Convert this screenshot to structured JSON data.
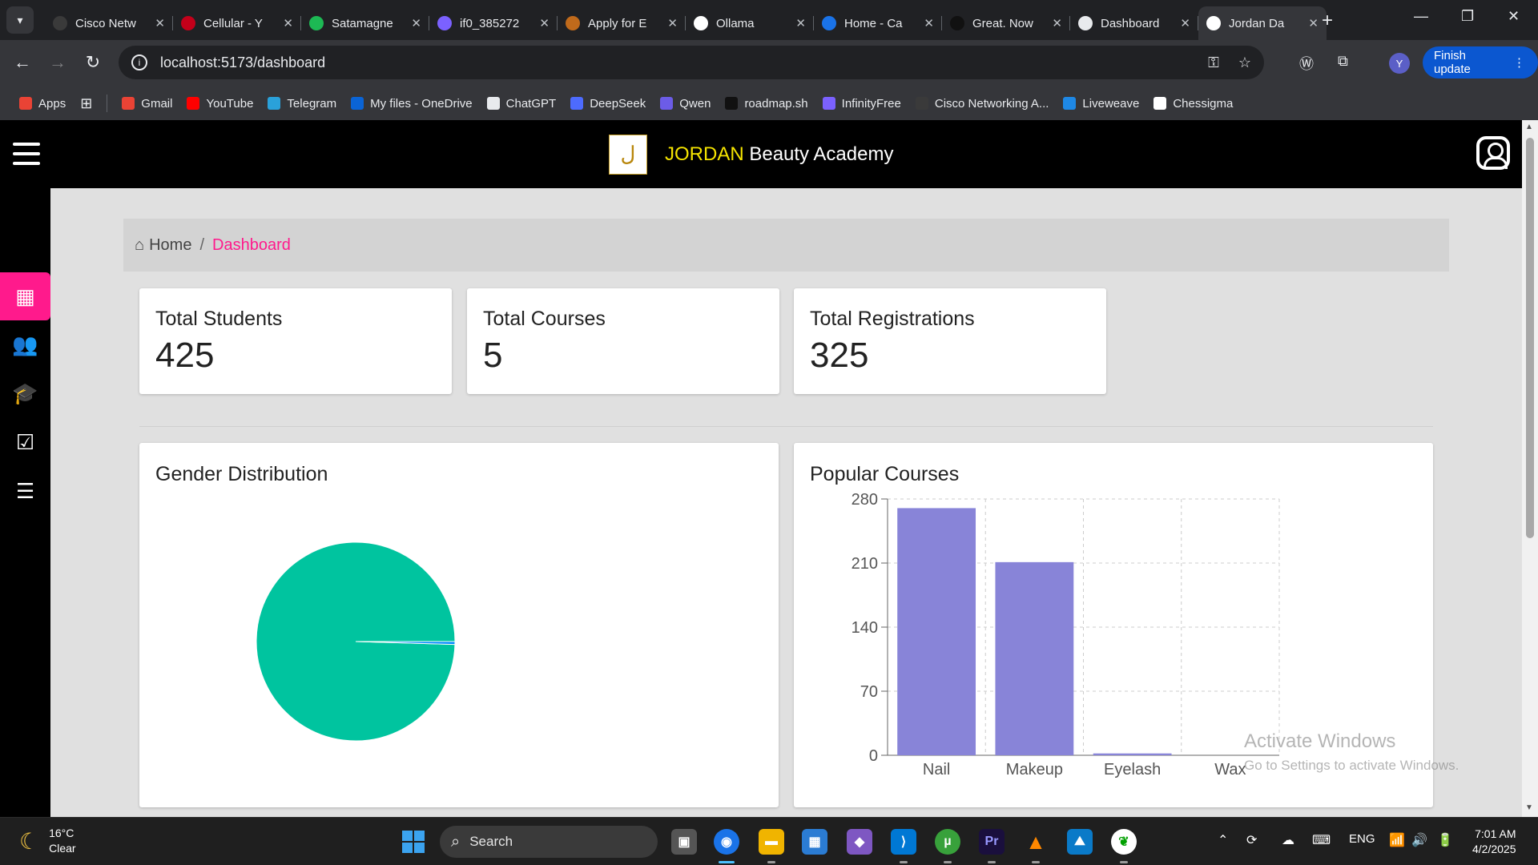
{
  "browser": {
    "tabs": [
      {
        "title": "Cisco Netw",
        "color": "#3a3a3a"
      },
      {
        "title": "Cellular - Y",
        "color": "#c4001a"
      },
      {
        "title": "Satamagne",
        "color": "#1db954"
      },
      {
        "title": "if0_385272",
        "color": "#7b61ff"
      },
      {
        "title": "Apply for E",
        "color": "#c06a1b"
      },
      {
        "title": "Ollama",
        "color": "#ffffff"
      },
      {
        "title": "Home - Ca",
        "color": "#1a73e8"
      },
      {
        "title": "Great. Now",
        "color": "#111111"
      },
      {
        "title": "Dashboard",
        "color": "#e8eaed"
      },
      {
        "title": "Jordan Da",
        "color": "#ffffff"
      }
    ],
    "url": "localhost:5173/dashboard",
    "finish_update": "Finish update",
    "profile_initial": "Y",
    "bookmarks": [
      {
        "label": "Apps",
        "color": "#ea4335"
      },
      {
        "label": "Gmail",
        "color": "#ea4335"
      },
      {
        "label": "YouTube",
        "color": "#ff0000"
      },
      {
        "label": "Telegram",
        "color": "#2aa1da"
      },
      {
        "label": "My files - OneDrive",
        "color": "#0a64d6"
      },
      {
        "label": "ChatGPT",
        "color": "#e8eaed"
      },
      {
        "label": "DeepSeek",
        "color": "#4d6bfe"
      },
      {
        "label": "Qwen",
        "color": "#6c5ce7"
      },
      {
        "label": "roadmap.sh",
        "color": "#111111"
      },
      {
        "label": "InfinityFree",
        "color": "#7b61ff"
      },
      {
        "label": "Cisco Networking A...",
        "color": "#3a3a3a"
      },
      {
        "label": "Liveweave",
        "color": "#1e88e5"
      },
      {
        "label": "Chessigma",
        "color": "#ffffff"
      }
    ]
  },
  "app": {
    "brand_highlight": "JORDAN",
    "brand_rest": " Beauty Academy",
    "breadcrumb": {
      "home": "Home",
      "separator": "/",
      "current": "Dashboard"
    },
    "stats": [
      {
        "label": "Total Students",
        "value": "425"
      },
      {
        "label": "Total Courses",
        "value": "5"
      },
      {
        "label": "Total Registrations",
        "value": "325"
      }
    ],
    "gender_title": "Gender Distribution",
    "courses_title": "Popular Courses",
    "accent": "#ff1a8c"
  },
  "chart_data": [
    {
      "type": "pie",
      "title": "Gender Distribution",
      "slices": [
        {
          "name": "",
          "value": 423,
          "color": "#00c49f"
        },
        {
          "name": "",
          "value": 2,
          "color": "#0088fe"
        }
      ]
    },
    {
      "type": "bar",
      "title": "Popular Courses",
      "categories": [
        "Nail",
        "Makeup",
        "Eyelash",
        "Wax"
      ],
      "values": [
        270,
        211,
        2,
        0
      ],
      "ylim": [
        0,
        280
      ],
      "yticks": [
        0,
        70,
        140,
        210,
        280
      ],
      "grid": true,
      "color": "#8884d8"
    }
  ],
  "watermark": {
    "line1": "Activate Windows",
    "line2": "Go to Settings to activate Windows."
  },
  "taskbar": {
    "temp": "16°C",
    "condition": "Clear",
    "search": "Search",
    "lang": "ENG",
    "time": "7:01 AM",
    "date": "4/2/2025"
  }
}
